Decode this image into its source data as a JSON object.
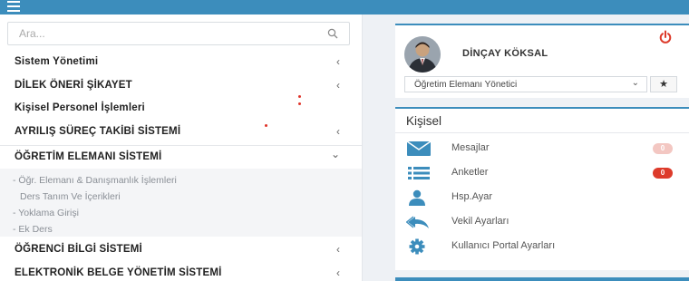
{
  "search": {
    "placeholder": "Ara..."
  },
  "menu": {
    "sistem": "Sistem Yönetimi",
    "dilek": "DİLEK ÖNERİ ŞİKAYET",
    "kisisel_personel": "Kişisel Personel İşlemleri",
    "ayrilis": "AYRILIŞ SÜREÇ TAKİBİ SİSTEMİ",
    "ogretim": "ÖĞRETİM ELEMANI SİSTEMİ",
    "ogrenci": "ÖĞRENCİ BİLGİ SİSTEMİ",
    "ebys": "ELEKTRONİK BELGE YÖNETİM SİSTEMİ",
    "chevron_left": "‹",
    "chevron_down": "⌄"
  },
  "submenu": [
    "- Öğr. Elemanı & Danışmanlık İşlemleri",
    "Ders Tanım Ve İçerikleri",
    "- Yoklama Girişi",
    "- Ek Ders"
  ],
  "profile": {
    "name": "DİNÇAY KÖKSAL",
    "role": "Öğretim Elemanı Yönetici",
    "star": "★",
    "caret": "⌄"
  },
  "personal": {
    "title": "Kişisel",
    "items": [
      "Mesajlar",
      "Anketler",
      "Hsp.Ayar",
      "Vekil Ayarları",
      "Kullanıcı Portal Ayarları"
    ],
    "badges": {
      "mesajlar": "0",
      "anketler": "0"
    }
  },
  "colors": {
    "topbar": "#3c8dbc",
    "accent_red": "#dd3b2b",
    "icon_blue": "#3c8dbc"
  }
}
